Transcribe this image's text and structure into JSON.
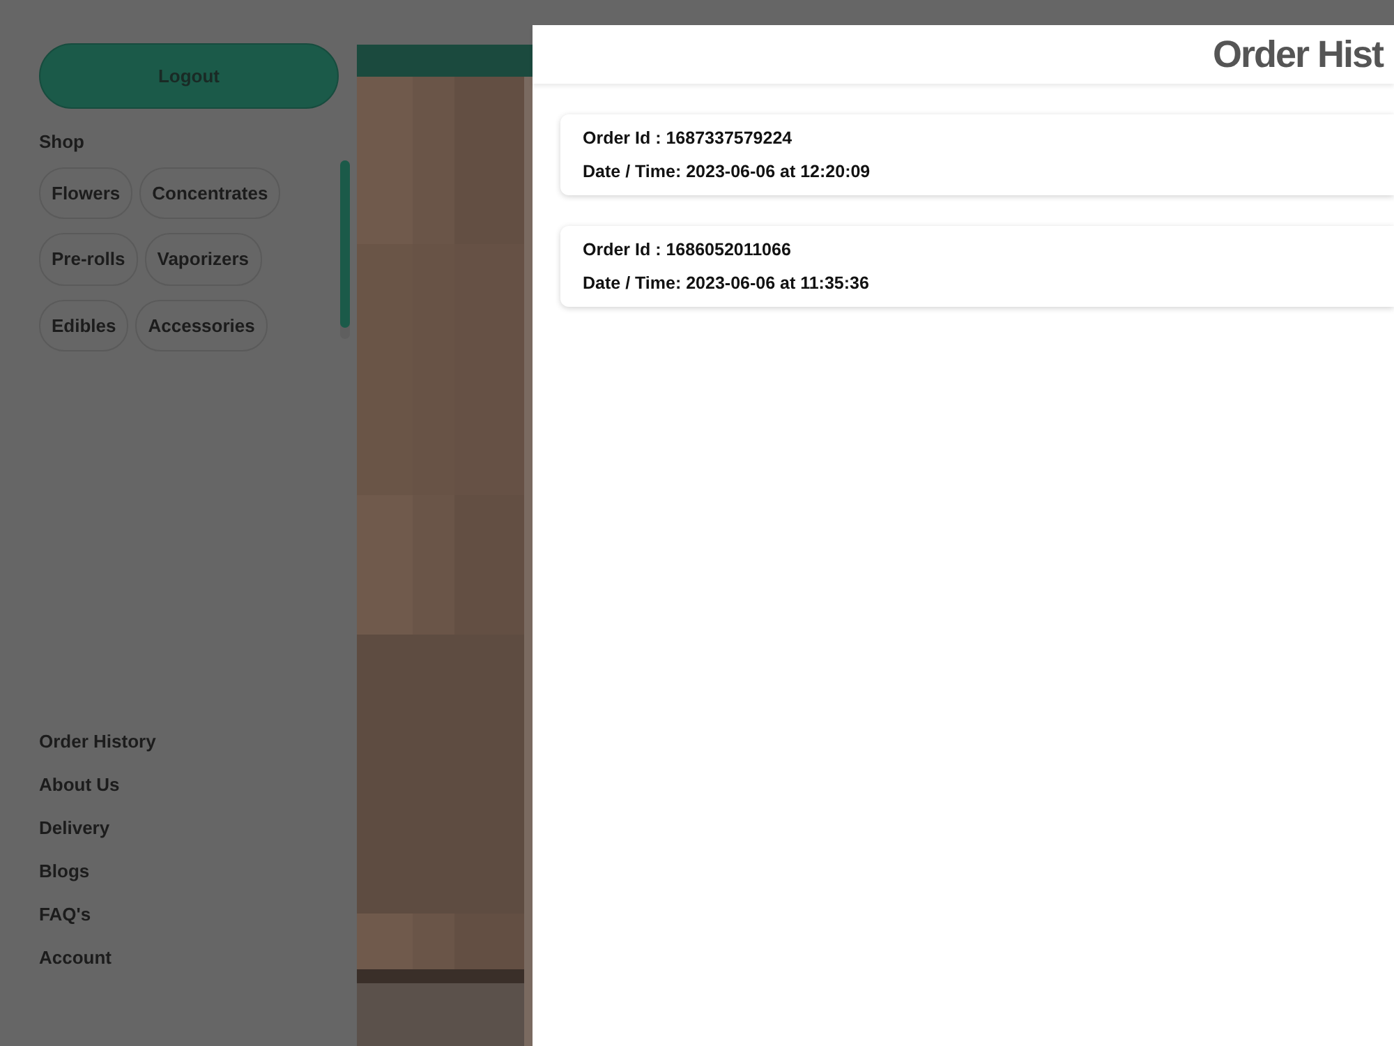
{
  "sidebar": {
    "logout_button": "Logout",
    "shop_heading": "Shop",
    "categories": [
      "Flowers",
      "Concentrates",
      "Pre-rolls",
      "Vaporizers",
      "Edibles",
      "Accessories"
    ],
    "links": [
      "Order History",
      "About Us",
      "Delivery",
      "Blogs",
      "FAQ's",
      "Account"
    ]
  },
  "modal": {
    "title": "Order Hist",
    "orders": [
      {
        "order_id": "Order Id : 1687337579224",
        "date_time": "Date / Time: 2023-06-06 at 12:20:09"
      },
      {
        "order_id": "Order Id : 1686052011066",
        "date_time": "Date / Time: 2023-06-06 at 11:35:36"
      }
    ]
  }
}
